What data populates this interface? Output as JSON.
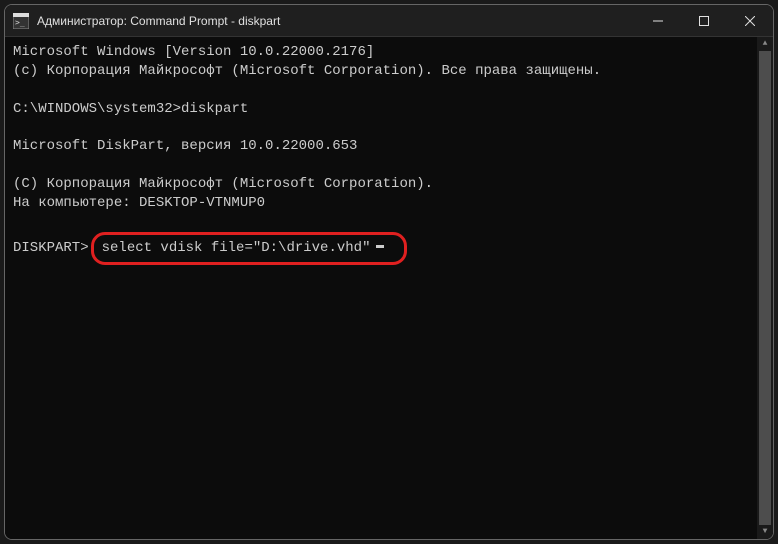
{
  "window": {
    "title": "Администратор: Command Prompt - diskpart"
  },
  "terminal": {
    "line1": "Microsoft Windows [Version 10.0.22000.2176]",
    "line2": "(c) Корпорация Майкрософт (Microsoft Corporation). Все права защищены.",
    "prompt1_prefix": "C:\\WINDOWS\\system32>",
    "prompt1_cmd": "diskpart",
    "line3": "Microsoft DiskPart, версия 10.0.22000.653",
    "line4": "(C) Корпорация Майкрософт (Microsoft Corporation).",
    "line5": "На компьютере: DESKTOP-VTNMUP0",
    "diskpart_prompt": "DISKPART>",
    "diskpart_cmd": "select vdisk file=\"D:\\drive.vhd\""
  }
}
